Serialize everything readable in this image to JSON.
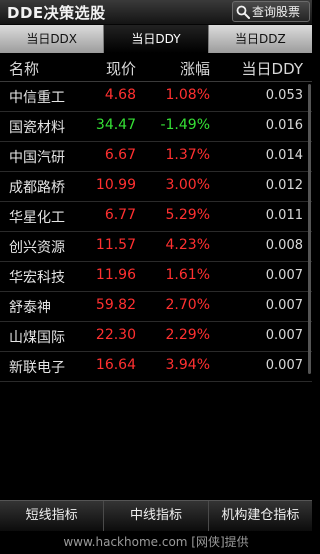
{
  "header": {
    "title": "DDE决策选股",
    "search_label": "查询股票",
    "search_icon": "search-icon"
  },
  "tabs": [
    {
      "label": "当日DDX",
      "active": false
    },
    {
      "label": "当日DDY",
      "active": true
    },
    {
      "label": "当日DDZ",
      "active": false
    }
  ],
  "columns": {
    "name": "名称",
    "price": "现价",
    "change": "涨幅",
    "dde": "当日DDY"
  },
  "rows": [
    {
      "name": "中信重工",
      "price": "4.68",
      "change": "1.08%",
      "dde": "0.053",
      "dir": "up"
    },
    {
      "name": "国瓷材料",
      "price": "34.47",
      "change": "-1.49%",
      "dde": "0.016",
      "dir": "down"
    },
    {
      "name": "中国汽研",
      "price": "6.67",
      "change": "1.37%",
      "dde": "0.014",
      "dir": "up"
    },
    {
      "name": "成都路桥",
      "price": "10.99",
      "change": "3.00%",
      "dde": "0.012",
      "dir": "up"
    },
    {
      "name": "华星化工",
      "price": "6.77",
      "change": "5.29%",
      "dde": "0.011",
      "dir": "up"
    },
    {
      "name": "创兴资源",
      "price": "11.57",
      "change": "4.23%",
      "dde": "0.008",
      "dir": "up"
    },
    {
      "name": "华宏科技",
      "price": "11.96",
      "change": "1.61%",
      "dde": "0.007",
      "dir": "up"
    },
    {
      "name": "舒泰神",
      "price": "59.82",
      "change": "2.70%",
      "dde": "0.007",
      "dir": "up"
    },
    {
      "name": "山煤国际",
      "price": "22.30",
      "change": "2.29%",
      "dde": "0.007",
      "dir": "up"
    },
    {
      "name": "新联电子",
      "price": "16.64",
      "change": "3.94%",
      "dde": "0.007",
      "dir": "up"
    }
  ],
  "bottom_nav": [
    "短线指标",
    "中线指标",
    "机构建仓指标"
  ],
  "watermark": "www.hackhome.com [网侠]提供",
  "colors": {
    "up": "#ff3030",
    "down": "#35e035",
    "background": "#000000"
  }
}
